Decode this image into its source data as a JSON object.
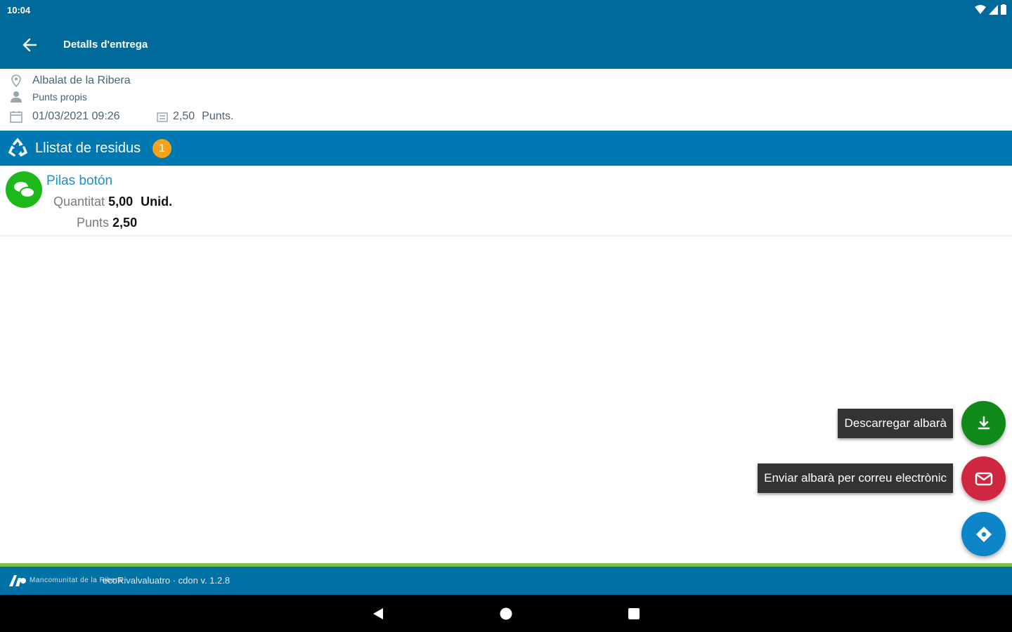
{
  "status_bar": {
    "time": "10:04"
  },
  "app_bar": {
    "title": "Detalls d'entrega"
  },
  "info": {
    "location": "Albalat de la Ribera",
    "user": "Punts propis",
    "date": "01/03/2021 09:26",
    "points": "2,50",
    "points_unit": "Punts."
  },
  "section": {
    "title": "Llistat de residus",
    "count": "1"
  },
  "residues": [
    {
      "name": "Pilas botón",
      "quantity_label": "Quantitat",
      "quantity": "5,00",
      "unit": "Unid.",
      "points_label": "Punts",
      "points": "2,50"
    }
  ],
  "actions": {
    "download_label": "Descarregar albarà",
    "email_label": "Enviar albarà per correu electrònic"
  },
  "footer": {
    "brand": "Mancomunitat de la Ribera",
    "text": "ecoRivalvaluatro · cdon v. 1.2.8"
  },
  "colors": {
    "primary": "#006b9a",
    "section": "#0079b2",
    "accent": "#f6a31c",
    "green": "#1db91b",
    "red": "#cf2642"
  }
}
